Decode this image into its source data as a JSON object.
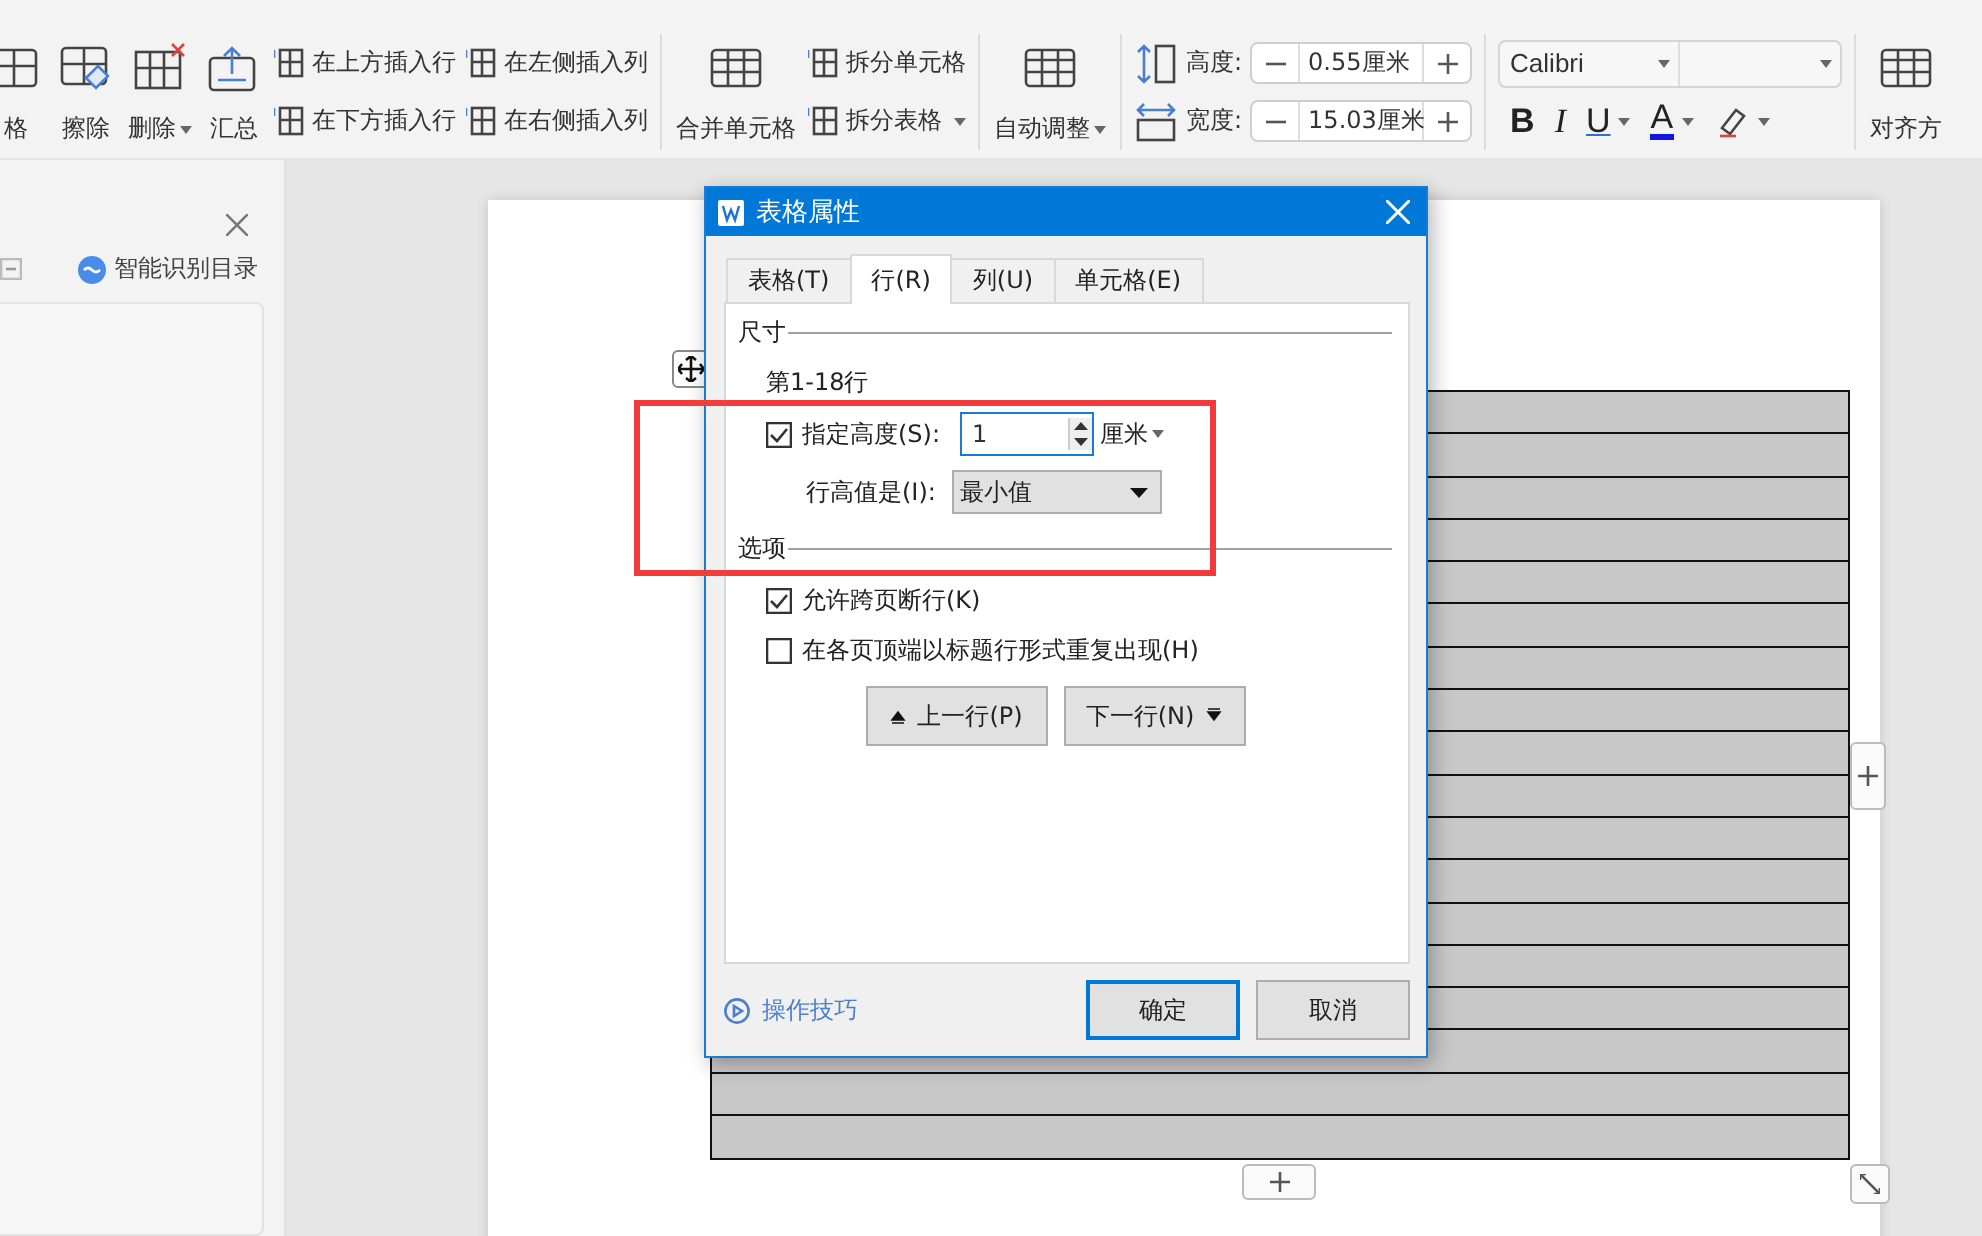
{
  "ribbon": [
    {
      "columns": [
        {
          "kind": "large",
          "label": "格",
          "dropdown": false
        },
        {
          "kind": "large",
          "label": "擦除",
          "dropdown": false
        },
        {
          "kind": "large",
          "label": "删除",
          "dropdown": true
        },
        {
          "kind": "large",
          "label": "汇总",
          "dropdown": false
        },
        {
          "kind": "stack",
          "buttons": [
            {
              "label": "在上方插入行",
              "dropdown": false
            },
            {
              "label": "在下方插入行",
              "dropdown": false
            }
          ]
        },
        {
          "kind": "stack",
          "buttons": [
            {
              "label": "在左侧插入列",
              "dropdown": false
            },
            {
              "label": "在右侧插入列",
              "dropdown": false
            }
          ]
        }
      ]
    },
    {
      "columns": [
        {
          "kind": "large",
          "label": "合并单元格",
          "dropdown": false
        },
        {
          "kind": "stack",
          "buttons": [
            {
              "label": "拆分单元格",
              "dropdown": false
            },
            {
              "label": "拆分表格",
              "dropdown": true
            }
          ]
        }
      ]
    },
    {
      "columns": [
        {
          "kind": "large",
          "label": "自动调整",
          "dropdown": true
        }
      ]
    },
    {
      "columns": [
        {
          "kind": "size",
          "fields": [
            {
              "label": "高度:",
              "value": "0.55厘米"
            },
            {
              "label": "宽度:",
              "value": "15.03厘米"
            }
          ]
        }
      ]
    },
    {
      "columns": [
        {
          "kind": "font",
          "font": "Calibri",
          "buttons": [
            {
              "label": "B",
              "dropdown": false
            },
            {
              "label": "I",
              "dropdown": false
            },
            {
              "label": "U",
              "dropdown": true
            },
            {
              "label": "A",
              "dropdown": true
            },
            {
              "dropdown": true
            }
          ]
        }
      ]
    },
    {
      "columns": [
        {
          "kind": "large",
          "label": "对齐方",
          "dropdown": false
        }
      ]
    }
  ],
  "side_panel": {
    "toc_button": "智能识别目录"
  },
  "dialog": {
    "title": "表格属性",
    "tabs": [
      {
        "label": "表格(T)",
        "selected": false
      },
      {
        "label": "行(R)",
        "selected": true
      },
      {
        "label": "列(U)",
        "selected": false
      },
      {
        "label": "单元格(E)",
        "selected": false
      }
    ],
    "size_section": {
      "title": "尺寸",
      "rows_label": "第1-18行",
      "height_checkbox": {
        "label": "指定高度(S):",
        "checked": true
      },
      "height_value": "1",
      "unit": "厘米",
      "height_rule_label": "行高值是(I):",
      "height_rule": "最小值"
    },
    "options_section": {
      "title": "选项",
      "options": [
        {
          "label": "允许跨页断行(K)",
          "checked": true
        },
        {
          "label": "在各页顶端以标题行形式重复出现(H)",
          "checked": false
        }
      ]
    },
    "nav_buttons": [
      {
        "label": "上一行(P)",
        "kind": "prev"
      },
      {
        "label": "下一行(N)",
        "kind": "next"
      }
    ],
    "tips_link": "操作技巧",
    "buttons": [
      {
        "label": "确定",
        "focused": true
      },
      {
        "label": "取消",
        "focused": false
      }
    ]
  }
}
